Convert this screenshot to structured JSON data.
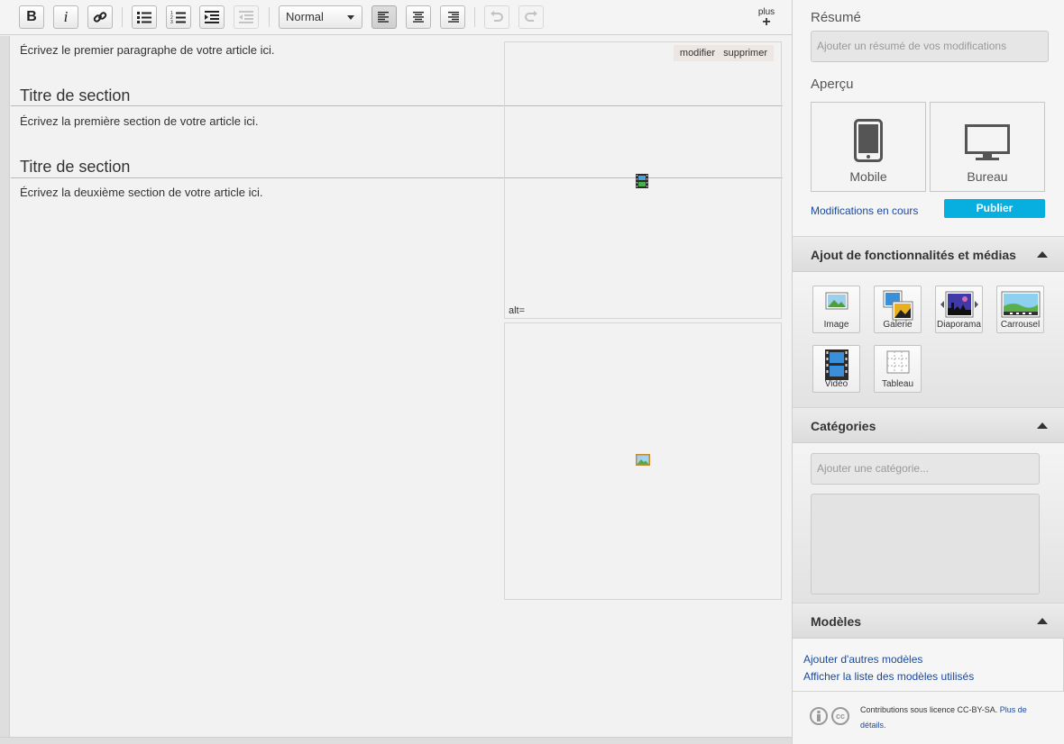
{
  "toolbar": {
    "bold": "B",
    "italic": "i",
    "format_value": "Normal",
    "more_label": "plus",
    "more_plus": "+"
  },
  "article": {
    "intro": "Écrivez le premier paragraphe de votre article ici.",
    "sections": [
      {
        "title": "Titre de section",
        "text": "Écrivez la première section de votre article ici."
      },
      {
        "title": "Titre de section",
        "text": "Écrivez la deuxième section de votre article ici."
      }
    ],
    "media_actions": {
      "edit": "modifier",
      "delete": "supprimer"
    },
    "alt_label": "alt="
  },
  "sidebar": {
    "summary": {
      "label": "Résumé",
      "placeholder": "Ajouter un résumé de vos modifications"
    },
    "preview": {
      "label": "Aperçu",
      "mobile": "Mobile",
      "desktop": "Bureau"
    },
    "modifications_link": "Modifications en cours",
    "publish_label": "Publier",
    "features": {
      "title": "Ajout de fonctionnalités et médias",
      "items": [
        "Image",
        "Galerie",
        "Diaporama",
        "Carrousel",
        "Vidéo",
        "Tableau"
      ]
    },
    "categories": {
      "title": "Catégories",
      "placeholder": "Ajouter une catégorie..."
    },
    "templates": {
      "title": "Modèles",
      "add_link": "Ajouter d'autres modèles",
      "list_link": "Afficher la liste des modèles utilisés"
    },
    "license": {
      "text": "Contributions sous licence CC-BY-SA.",
      "link": "Plus de détails."
    }
  },
  "icons": {
    "bold": "bold-icon",
    "italic": "italic-icon",
    "link": "link-icon",
    "bullets": "bulleted-list-icon",
    "numbers": "numbered-list-icon",
    "indent": "indent-icon",
    "outdent": "outdent-icon",
    "align_left": "align-left-icon",
    "align_center": "align-center-icon",
    "align_right": "align-right-icon",
    "undo": "undo-icon",
    "redo": "redo-icon"
  },
  "colors": {
    "publish": "#07aee0",
    "link": "#1a4aa0"
  }
}
